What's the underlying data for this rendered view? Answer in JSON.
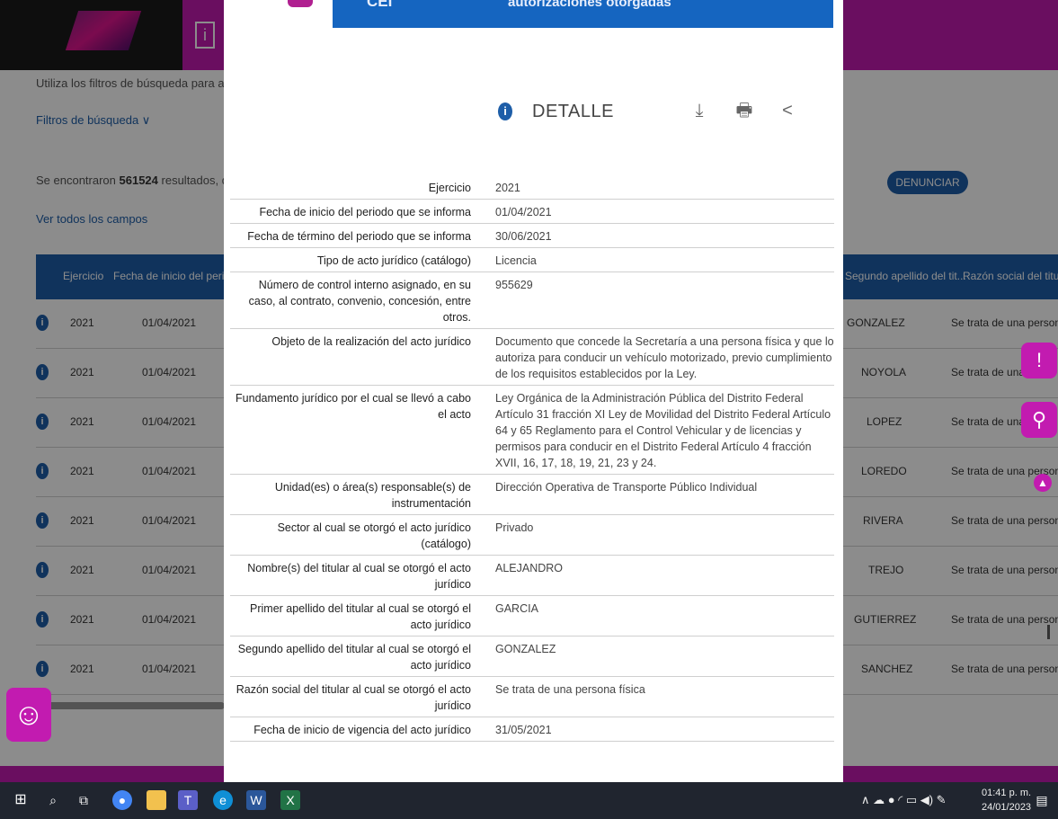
{
  "background": {
    "hint_text": "Utiliza los filtros de búsqueda para acotar",
    "filters_label": "Filtros de búsqueda ∨",
    "results_prefix": "Se encontraron ",
    "results_count": "561524",
    "results_suffix": " resultados, da clic",
    "view_all_fields": "Ver todos los campos",
    "denunciar_label": "DENUNCIAR",
    "table_headers": [
      "Ejercicio",
      "Fecha de inicio del peri...",
      "Segundo apellido del tit...",
      "Razón social del titula"
    ],
    "rows": [
      {
        "year": "2021",
        "date": "01/04/2021",
        "surname": "GONZALEZ",
        "razon": "Se trata de una persona"
      },
      {
        "year": "2021",
        "date": "01/04/2021",
        "surname": "NOYOLA",
        "razon": "Se trata de una p"
      },
      {
        "year": "2021",
        "date": "01/04/2021",
        "surname": "LOPEZ",
        "razon": "Se trata de una p"
      },
      {
        "year": "2021",
        "date": "01/04/2021",
        "surname": "LOREDO",
        "razon": "Se trata de una persona"
      },
      {
        "year": "2021",
        "date": "01/04/2021",
        "surname": "RIVERA",
        "razon": "Se trata de una persona"
      },
      {
        "year": "2021",
        "date": "01/04/2021",
        "surname": "TREJO",
        "razon": "Se trata de una persona"
      },
      {
        "year": "2021",
        "date": "01/04/2021",
        "surname": "GUTIERREZ",
        "razon": "Se trata de una persona"
      },
      {
        "year": "2021",
        "date": "01/04/2021",
        "surname": "SANCHEZ",
        "razon": "Se trata de una persona"
      }
    ]
  },
  "modal": {
    "banner_left": "CEI",
    "banner_title": "autorizaciones otorgadas",
    "detail_title": "DETALLE",
    "fields": [
      {
        "label": "Ejercicio",
        "value": "2021"
      },
      {
        "label": "Fecha de inicio del periodo que se informa",
        "value": "01/04/2021"
      },
      {
        "label": "Fecha de término del periodo que se informa",
        "value": "30/06/2021"
      },
      {
        "label": "Tipo de acto jurídico (catálogo)",
        "value": "Licencia"
      },
      {
        "label": "Número de control interno asignado, en su caso, al contrato, convenio, concesión, entre otros.",
        "value": "955629"
      },
      {
        "label": "Objeto de la realización del acto jurídico",
        "value": "Documento que concede la Secretaría a una persona física y que lo autoriza para conducir un vehículo motorizado, previo cumplimiento de los requisitos establecidos por la Ley."
      },
      {
        "label": "Fundamento jurídico por el cual se llevó a cabo el acto",
        "value": "Ley Orgánica de la Administración Pública del Distrito Federal Artículo 31 fracción XI Ley de Movilidad del Distrito Federal Artículo 64 y 65 Reglamento para el Control Vehicular y de licencias y permisos para conducir en el Distrito Federal Artículo 4 fracción XVII, 16, 17, 18, 19, 21, 23 y 24."
      },
      {
        "label": "Unidad(es) o área(s) responsable(s) de instrumentación",
        "value": "Dirección Operativa de Transporte Público Individual"
      },
      {
        "label": "Sector al cual se otorgó el acto jurídico (catálogo)",
        "value": "Privado"
      },
      {
        "label": "Nombre(s) del titular al cual se otorgó el acto jurídico",
        "value": "ALEJANDRO"
      },
      {
        "label": "Primer apellido del titular al cual se otorgó el acto jurídico",
        "value": "GARCIA"
      },
      {
        "label": "Segundo apellido del titular al cual se otorgó el acto jurídico",
        "value": "GONZALEZ"
      },
      {
        "label": "Razón social del titular al cual se otorgó el acto jurídico",
        "value": "Se trata de una persona física"
      },
      {
        "label": "Fecha de inicio de vigencia del acto jurídico",
        "value": "31/05/2021"
      }
    ]
  },
  "taskbar": {
    "time": "01:41 p. m.",
    "date": "24/01/2023"
  },
  "colors": {
    "brand_magenta": "#c21bb0",
    "primary_blue": "#1e5ea8",
    "banner_blue": "#1565c0"
  }
}
